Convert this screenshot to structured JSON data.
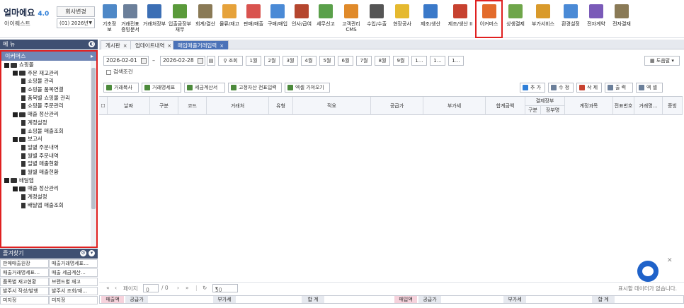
{
  "app": {
    "logo_main": "얼마에요",
    "logo_ver": "4.0",
    "company": "아이퀘스트",
    "company_btn": "회사변경",
    "year": "(01) 2026년"
  },
  "toolbar": [
    {
      "label": "기초정보",
      "icon": "base-info-icon",
      "color": "#4e88c7"
    },
    {
      "label": "거래전표\n증빙문서",
      "icon": "voucher-icon",
      "color": "#6b7f9a"
    },
    {
      "label": "거래처장부",
      "icon": "ledger-icon",
      "color": "#3c6fb5"
    },
    {
      "label": "입출금장부\n재무",
      "icon": "cashbook-icon",
      "color": "#5a9a3a"
    },
    {
      "label": "회계/결산",
      "icon": "accounting-icon",
      "color": "#8a7a56"
    },
    {
      "label": "물류/재고",
      "icon": "logistics-icon",
      "color": "#e6a23a"
    },
    {
      "label": "판매/매출",
      "icon": "sales-icon",
      "color": "#d9534f"
    },
    {
      "label": "구매/매입",
      "icon": "purchase-icon",
      "color": "#4a8ad6"
    },
    {
      "label": "인사/급여",
      "icon": "hr-icon",
      "color": "#b5462e"
    },
    {
      "label": "세무신고",
      "icon": "tax-icon",
      "color": "#5aa04a"
    },
    {
      "label": "고객관리\nCMS",
      "icon": "crm-icon",
      "color": "#e08a2a"
    },
    {
      "label": "수입/수출",
      "icon": "trade-icon",
      "color": "#555555"
    },
    {
      "label": "현장공사",
      "icon": "construction-icon",
      "color": "#e5b92f"
    },
    {
      "label": "제조/생산",
      "icon": "manufacturing-icon",
      "color": "#3a79c9"
    },
    {
      "label": "제조/생산 II",
      "icon": "factory-icon",
      "color": "#c7412f"
    },
    {
      "label": "이커머스",
      "icon": "ecommerce-icon",
      "color": "#e36b2b"
    },
    {
      "label": "상생결제",
      "icon": "payment-icon",
      "color": "#6fa64a"
    },
    {
      "label": "부가서비스",
      "icon": "service-icon",
      "color": "#d99a2b"
    },
    {
      "label": "환경설정",
      "icon": "settings-icon",
      "color": "#4a8ad6"
    },
    {
      "label": "전자계약",
      "icon": "contract-icon",
      "color": "#7a5ab8"
    },
    {
      "label": "전자결재",
      "icon": "approval-icon",
      "color": "#8a7a56"
    }
  ],
  "toolbar_selected": 15,
  "sidebar": {
    "menu_title": "메 뉴",
    "section_title": "이커머스",
    "items": [
      {
        "level": 0,
        "type": "folder",
        "label": "쇼핑몰"
      },
      {
        "level": 1,
        "type": "folder",
        "label": "주문 재고관리"
      },
      {
        "level": 2,
        "type": "doc",
        "label": "쇼핑몰 관리"
      },
      {
        "level": 2,
        "type": "doc",
        "label": "쇼핑몰 품목연결"
      },
      {
        "level": 2,
        "type": "doc",
        "label": "품목별 쇼핑몰 관리"
      },
      {
        "level": 2,
        "type": "doc",
        "label": "쇼핑몰 주문관리"
      },
      {
        "level": 1,
        "type": "folder",
        "label": "매출 정산관리"
      },
      {
        "level": 2,
        "type": "doc",
        "label": "계정설정"
      },
      {
        "level": 2,
        "type": "doc",
        "label": "쇼핑몰 매출조회"
      },
      {
        "level": 1,
        "type": "folder",
        "label": "보고서"
      },
      {
        "level": 2,
        "type": "doc",
        "label": "일별 주문내역"
      },
      {
        "level": 2,
        "type": "doc",
        "label": "월별 주문내역"
      },
      {
        "level": 2,
        "type": "doc",
        "label": "일별 매출현황"
      },
      {
        "level": 2,
        "type": "doc",
        "label": "월별 매출현황"
      },
      {
        "level": 0,
        "type": "folder",
        "label": "배달앱"
      },
      {
        "level": 1,
        "type": "folder",
        "label": "매출 정산관리"
      },
      {
        "level": 2,
        "type": "doc",
        "label": "계정설정"
      },
      {
        "level": 2,
        "type": "doc",
        "label": "배달앱 매출조회"
      }
    ]
  },
  "quick": {
    "title": "즐겨찾기",
    "items": [
      "판매매출원장",
      "매출거래명세표…",
      "매출거래명세표…",
      "매출 세금계산…",
      "품목별 재고현황",
      "브랜드별 재고",
      "발주서 작성/발행",
      "발주서 조회/재…",
      "미지정",
      "미지정"
    ]
  },
  "tabs": [
    {
      "label": "게시판",
      "active": false
    },
    {
      "label": "업데이트내역",
      "active": false
    },
    {
      "label": "매입매출거래입력",
      "active": true
    }
  ],
  "search": {
    "date_from": "2026-02-01",
    "date_to": "2026-02-28",
    "search_btn": "조회",
    "months": [
      "1월",
      "2월",
      "3월",
      "4월",
      "5월",
      "6월",
      "7월",
      "8월",
      "9월",
      "1…",
      "1…",
      "1…"
    ],
    "cond_label": "검색조건",
    "help": "도움말"
  },
  "actions_left": [
    "거래복사",
    "거래명세표",
    "세금계산서",
    "고정자산 전표입력",
    "엑셀 가져오기"
  ],
  "actions_right": [
    "추 가",
    "수 정",
    "삭 제",
    "출 력",
    "엑 셀"
  ],
  "grid": {
    "headers": [
      "날짜",
      "구분",
      "코드",
      "거래처",
      "유형",
      "적요",
      "공급가",
      "부가세",
      "합계금액",
      "결제장부",
      "계정과목",
      "전표번호",
      "거래명…",
      "증빙"
    ],
    "sub_headers": [
      "구분",
      "장부명"
    ]
  },
  "pager": {
    "page_label": "페이지",
    "page": "0",
    "total": "/ 0",
    "rows": "50",
    "status": "표시할 데이터가 없습니다."
  },
  "totals": {
    "sales": "매출액",
    "supply": "공급가",
    "vat": "부가세",
    "sum": "합 계",
    "purchase": "매입액"
  }
}
